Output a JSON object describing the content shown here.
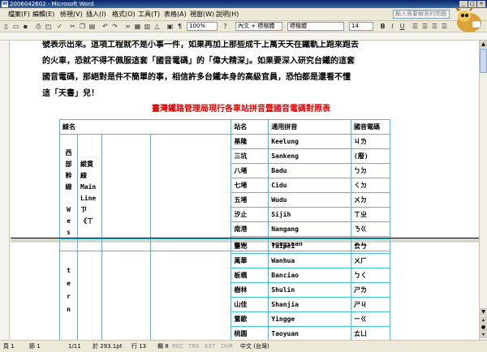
{
  "window": {
    "title": "2006042602 - Microsoft Word"
  },
  "menu": [
    "檔案(F)",
    "編輯(E)",
    "檢視(V)",
    "插入(I)",
    "格式(O)",
    "工具(T)",
    "表格(A)",
    "視窗(W)",
    "說明(H)"
  ],
  "help_box": {
    "placeholder": "輸入需要解答的問題"
  },
  "toolbar": {
    "zoom": "100%",
    "style": "內文 + 標楷體",
    "font": "標楷體",
    "size": "14"
  },
  "document": {
    "paragraph_lines": [
      "號表示出來。這項工程就不是小事一件，如果再加上那些成千上萬天天在鐵軌上跑來跑去",
      "的火車，恐就不得不佩服這套「國音電碼」的「偉大精深」。如果要深入研究台鐵的這套",
      "國音電碼，那絕對是件不簡單的事，相信許多台鐵本身的高級官員，恐怕都是還看不懂",
      "這「天書」兒！"
    ],
    "table_title": "臺灣鐵路管理局現行各車站拼音暨國音電碼對照表",
    "table_headers": {
      "line": "線名",
      "station": "站名",
      "pinyin": "通用拼音",
      "code": "國音電碼"
    },
    "line_vertical": "西\n部\n幹\n線\n\nW\ne\ns",
    "line_name": "縱貫線\nMain\nLine\nㄗ《ㄒ",
    "rows_page1": [
      {
        "station": "基隆",
        "pinyin": "Keelung",
        "code": "ㄐㄌ"
      },
      {
        "station": "三坑",
        "pinyin": "Sankeng",
        "code": "(廢)"
      },
      {
        "station": "八堵",
        "pinyin": "Badu",
        "code": "ㄅㄉ"
      },
      {
        "station": "七堵",
        "pinyin": "Cidu",
        "code": "ㄑㄉ"
      },
      {
        "station": "五堵",
        "pinyin": "Wudu",
        "code": "ㄨㄉ"
      },
      {
        "station": "汐止",
        "pinyin": "Sijih",
        "code": "ㄒㄓ"
      },
      {
        "station": "南港",
        "pinyin": "Nangang",
        "code": "ㄋㄍ"
      },
      {
        "station": "松山",
        "pinyin": "Songshan",
        "code": "ㄙㄙ"
      }
    ],
    "line_vertical_2": "t\ne\nr\nn",
    "rows_page2": [
      {
        "station": "臺北",
        "pinyin": "Taipei",
        "code": "ㄊㄅ"
      },
      {
        "station": "萬華",
        "pinyin": "Wanhua",
        "code": "ㄨㄏ"
      },
      {
        "station": "板橋",
        "pinyin": "Banciao",
        "code": "ㄅㄑ"
      },
      {
        "station": "樹林",
        "pinyin": "Shulin",
        "code": "ㄕㄌ"
      },
      {
        "station": "山佳",
        "pinyin": "Shanjia",
        "code": "ㄕㄐ"
      },
      {
        "station": "鶯歌",
        "pinyin": "Yingge",
        "code": "ㄧㄍ"
      },
      {
        "station": "桃園",
        "pinyin": "Taoyuan",
        "code": "ㄊㄩ"
      }
    ]
  },
  "status": {
    "page": "頁 1",
    "section": "節 1",
    "pages": "1/11",
    "at": "於 293.1pt",
    "line": "行 13",
    "col": "欄 8",
    "rec": "REC",
    "trk": "TRK",
    "ext": "EXT",
    "ovr": "OVR",
    "lang": "中文 (台灣)"
  }
}
